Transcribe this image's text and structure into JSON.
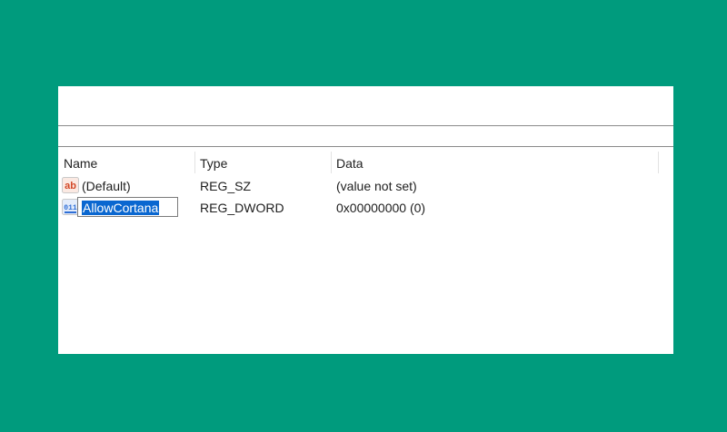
{
  "columns": {
    "name": "Name",
    "type": "Type",
    "data": "Data"
  },
  "rows": [
    {
      "icon": "string-value-icon",
      "name": "(Default)",
      "type": "REG_SZ",
      "data": "(value not set)"
    },
    {
      "icon": "binary-value-icon",
      "name": "AllowCortana",
      "type": "REG_DWORD",
      "data": "0x00000000 (0)",
      "editing": true
    }
  ],
  "icon_labels": {
    "string": "ab",
    "binary": "011"
  },
  "colors": {
    "background": "#009b7d",
    "selection": "#0a67d0",
    "string_icon": "#d24726",
    "binary_icon": "#2f6fd6"
  }
}
